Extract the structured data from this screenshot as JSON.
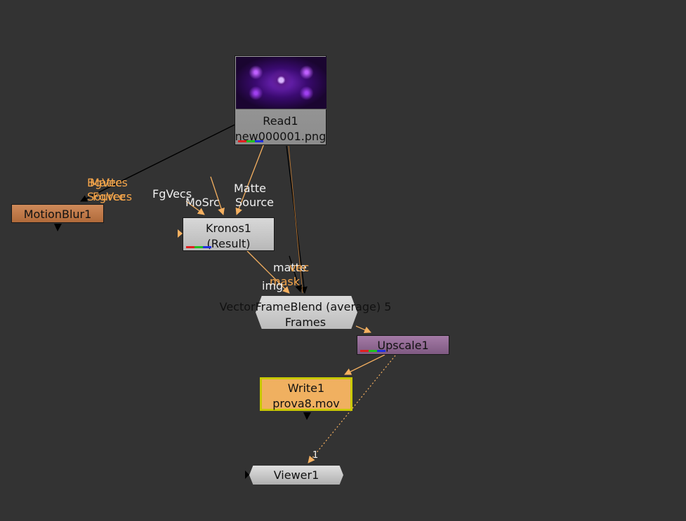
{
  "nodes": {
    "read": {
      "name": "Read1",
      "file": "new000001.png"
    },
    "motionblur": {
      "name": "MotionBlur1"
    },
    "kronos": {
      "name": "Kronos1",
      "sub": "(Result)"
    },
    "vectorframeblend": {
      "name": "VectorFrameBlend (average)",
      "sub": "5 Frames"
    },
    "upscale": {
      "name": "Upscale1"
    },
    "write": {
      "name": "Write1",
      "file": "prova8.mov"
    },
    "viewer": {
      "name": "Viewer1"
    }
  },
  "edge_labels": {
    "mb_bgvecs": "BgVecs",
    "mb_matte": "Matte",
    "mb_source": "Source",
    "mb_fgvecs": "FgVecs",
    "kr_fgvecs": "FgVecs",
    "kr_mosrc": "MoSrc",
    "kr_matte": "Matte",
    "kr_source": "Source",
    "vfb_matte": "matte",
    "vfb_vec": "vec",
    "vfb_mask": "mask",
    "vfb_img": "img",
    "viewer_input": "1"
  },
  "colors": {
    "background": "#333333",
    "edge_orange": "#f5b060",
    "edge_dark": "#111111",
    "read_node": "#8c8c8c",
    "motionblur_node": "#b06a3a",
    "kronos_node": "#c8c8c8",
    "upscale_node": "#8f6a92",
    "write_node": "#f0b060",
    "write_border": "#c8c800"
  }
}
